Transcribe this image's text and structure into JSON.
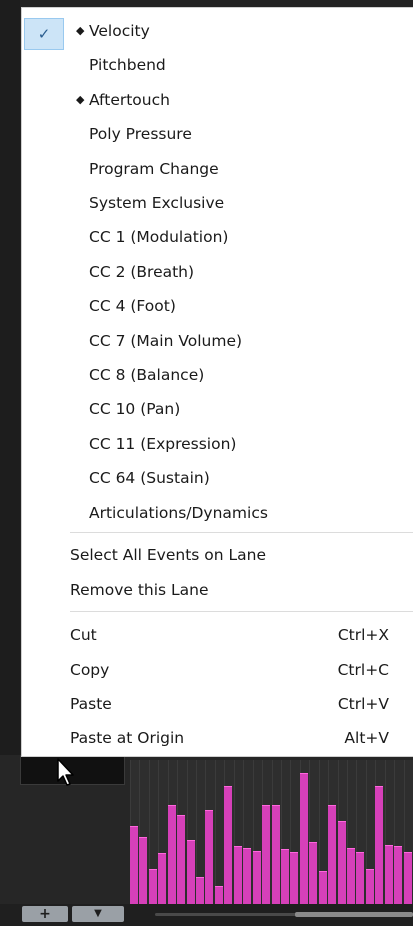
{
  "menu": {
    "lane_items": [
      {
        "label": "Velocity",
        "diamond": true,
        "checked": true
      },
      {
        "label": "Pitchbend",
        "diamond": false
      },
      {
        "label": "Aftertouch",
        "diamond": true
      },
      {
        "label": "Poly Pressure",
        "diamond": false
      },
      {
        "label": "Program Change",
        "diamond": false
      },
      {
        "label": "System Exclusive",
        "diamond": false
      },
      {
        "label": "CC 1  (Modulation)",
        "diamond": false
      },
      {
        "label": "CC 2  (Breath)",
        "diamond": false
      },
      {
        "label": "CC 4  (Foot)",
        "diamond": false
      },
      {
        "label": "CC 7  (Main Volume)",
        "diamond": false
      },
      {
        "label": "CC 8  (Balance)",
        "diamond": false
      },
      {
        "label": "CC 10  (Pan)",
        "diamond": false
      },
      {
        "label": "CC 11  (Expression)",
        "diamond": false
      },
      {
        "label": "CC 64  (Sustain)",
        "diamond": false
      },
      {
        "label": "Articulations/Dynamics",
        "diamond": false
      }
    ],
    "lane_commands": [
      {
        "label": "Select All Events on Lane"
      },
      {
        "label": "Remove this Lane"
      }
    ],
    "edit_commands": [
      {
        "label": "Cut",
        "shortcut": "Ctrl+X"
      },
      {
        "label": "Copy",
        "shortcut": "Ctrl+C"
      },
      {
        "label": "Paste",
        "shortcut": "Ctrl+V"
      },
      {
        "label": "Paste at Origin",
        "shortcut": "Alt+V"
      }
    ],
    "diamond_glyph": "◆",
    "check_glyph": "✓"
  },
  "editor": {
    "add_button_label": "+",
    "dropdown_button_label": "▼",
    "velocity_values": [
      0.55,
      0.47,
      0.25,
      0.36,
      0.69,
      0.62,
      0.45,
      0.2,
      0.66,
      0.14,
      0.82,
      0.41,
      0.4,
      0.38,
      0.69,
      0.69,
      0.39,
      0.37,
      0.91,
      0.44,
      0.24,
      0.69,
      0.58,
      0.4,
      0.37,
      0.25,
      0.82,
      0.42,
      0.41,
      0.37
    ],
    "velocity_color": "#d640b9"
  }
}
